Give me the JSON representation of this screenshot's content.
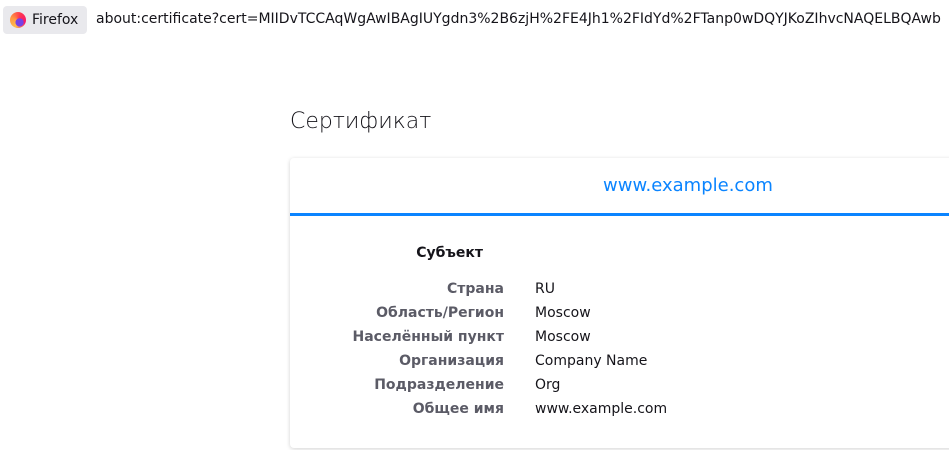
{
  "urlbar": {
    "identity_label": "Firefox",
    "url": "about:certificate?cert=MIIDvTCCAqWgAwIBAgIUYgdn3%2B6zjH%2FE4Jh1%2FIdYd%2FTanp0wDQYJKoZIhvcNAQELBQAwb"
  },
  "page": {
    "title": "Сертификат"
  },
  "certificate": {
    "tab_label": "www.example.com",
    "section_title": "Субъект",
    "rows": [
      {
        "label": "Страна",
        "value": "RU"
      },
      {
        "label": "Область/Регион",
        "value": "Moscow"
      },
      {
        "label": "Населённый пункт",
        "value": "Moscow"
      },
      {
        "label": "Организация",
        "value": "Company Name"
      },
      {
        "label": "Подразделение",
        "value": "Org"
      },
      {
        "label": "Общее имя",
        "value": "www.example.com"
      }
    ]
  },
  "colors": {
    "accent": "#0a84ff",
    "label_gray": "#5b5b66",
    "text": "#15141a"
  },
  "icons": {
    "identity": "firefox-logo-icon"
  }
}
